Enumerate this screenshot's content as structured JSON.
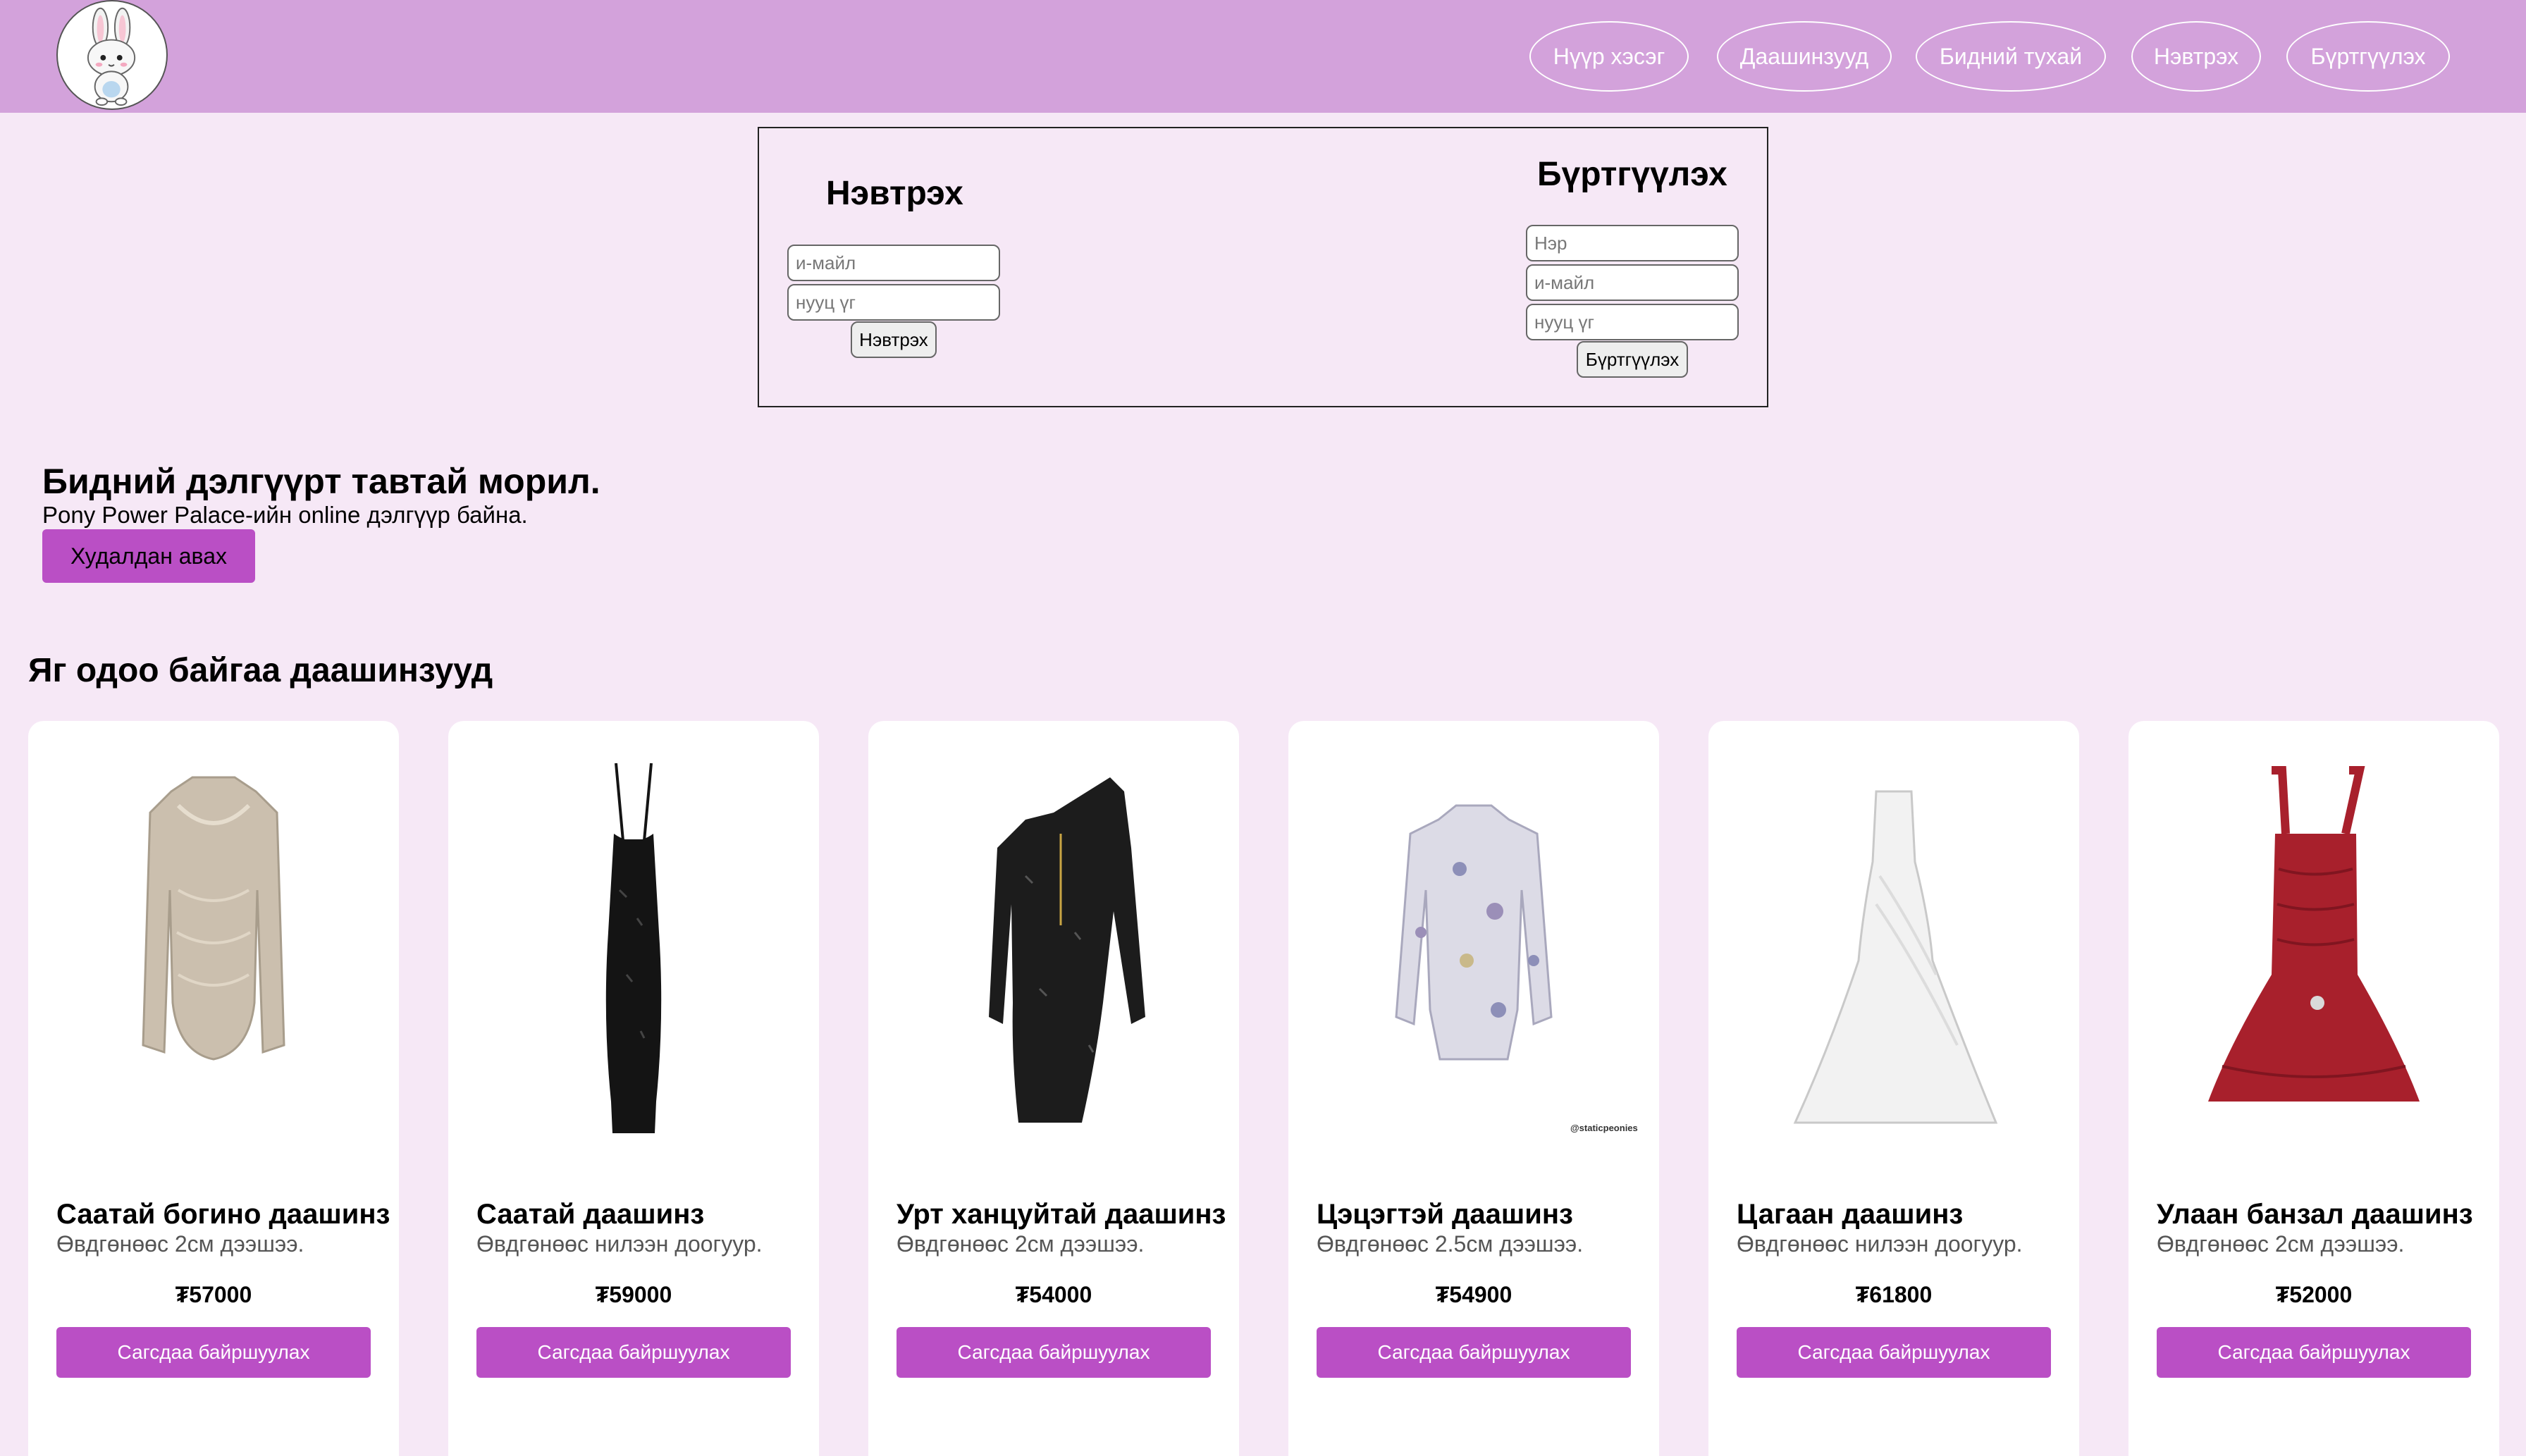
{
  "nav": {
    "items": [
      {
        "label": "Нүүр хэсэг"
      },
      {
        "label": "Даашинзууд"
      },
      {
        "label": "Бидний тухай"
      },
      {
        "label": "Нэвтрэх"
      },
      {
        "label": "Бүртгүүлэх"
      }
    ]
  },
  "login": {
    "title": "Нэвтрэх",
    "email_placeholder": "и-майл",
    "password_placeholder": "нууц үг",
    "button": "Нэвтрэх"
  },
  "register": {
    "title": "Бүртгүүлэх",
    "name_placeholder": "Нэр",
    "email_placeholder": "и-майл",
    "password_placeholder": "нууц үг",
    "button": "Бүртгүүлэх"
  },
  "hero": {
    "title": "Бидний дэлгүүрт тавтай морил.",
    "subtitle": "Pony Power Palace-ийн online дэлгүүр байна.",
    "button": "Худалдан авах"
  },
  "products_title": "Яг одоо байгаа даашинзууд",
  "products": [
    {
      "name": "Саатай богино даашинз",
      "desc": "Өвдгөнөөс 2см дээшээ.",
      "price": "₮57000",
      "button": "Сагсдаа байршуулах",
      "color": "#cbbfae"
    },
    {
      "name": "Саатай даашинз",
      "desc": "Өвдгөнөөс нилээн доогуур.",
      "price": "₮59000",
      "button": "Сагсдаа байршуулах",
      "color": "#141414"
    },
    {
      "name": "Урт ханцуйтай даашинз",
      "desc": "Өвдгөнөөс 2см дээшээ.",
      "price": "₮54000",
      "button": "Сагсдаа байршуулах",
      "color": "#1c1c1c"
    },
    {
      "name": "Цэцэгтэй даашинз",
      "desc": "Өвдгөнөөс 2.5см дээшээ.",
      "price": "₮54900",
      "button": "Сагсдаа байршуулах",
      "color": "#dcdbe6",
      "watermark": "@staticpeonies"
    },
    {
      "name": "Цагаан даашинз",
      "desc": "Өвдгөнөөс нилээн доогуур.",
      "price": "₮61800",
      "button": "Сагсдаа байршуулах",
      "color": "#f2f2f2"
    },
    {
      "name": "Улаан банзал даашинз",
      "desc": "Өвдгөнөөс 2см дээшээ.",
      "price": "₮52000",
      "button": "Сагсдаа байршуулах",
      "color": "#a8202c"
    }
  ],
  "colors": {
    "header_bg": "#d3a2db",
    "page_bg": "#f6e8f6",
    "accent": "#ba4fc5"
  }
}
